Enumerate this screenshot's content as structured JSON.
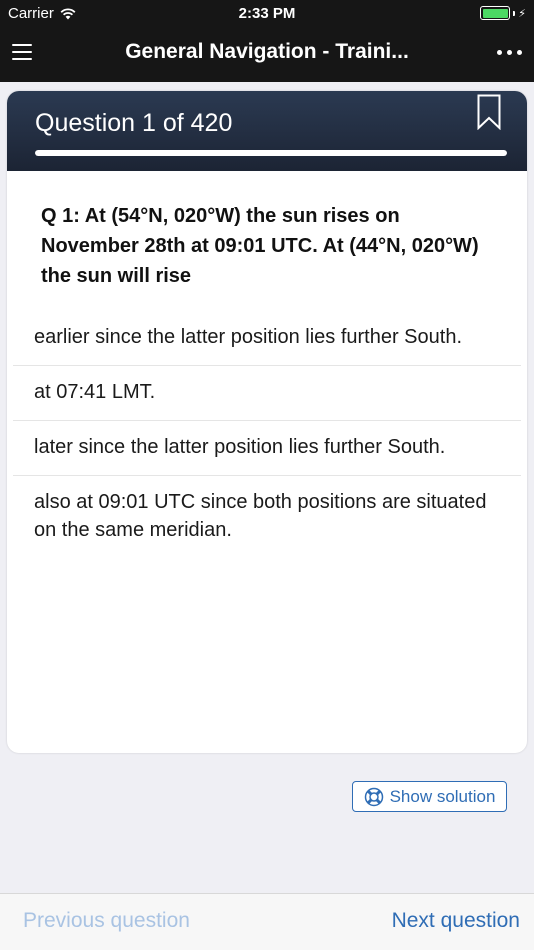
{
  "status_bar": {
    "carrier": "Carrier",
    "time": "2:33 PM"
  },
  "nav": {
    "title": "General Navigation - Traini..."
  },
  "card": {
    "counter": "Question 1 of 420",
    "progress": 0.0024,
    "question": "Q 1: At (54°N, 020°W) the sun rises on November 28th at 09:01 UTC. At (44°N, 020°W) the sun will rise",
    "answers": [
      "earlier since the latter position lies further South.",
      "at 07:41 LMT.",
      "later since the latter position lies further South.",
      "also at 09:01 UTC since both positions are situated on the same meridian."
    ]
  },
  "solution_button": {
    "label": "Show solution"
  },
  "footer": {
    "prev_label": "Previous question",
    "next_label": "Next question"
  },
  "colors": {
    "accent": "#2f6db5",
    "disabled": "#a9c3e3",
    "header_bg": "#1c2434",
    "battery": "#4cd964"
  }
}
